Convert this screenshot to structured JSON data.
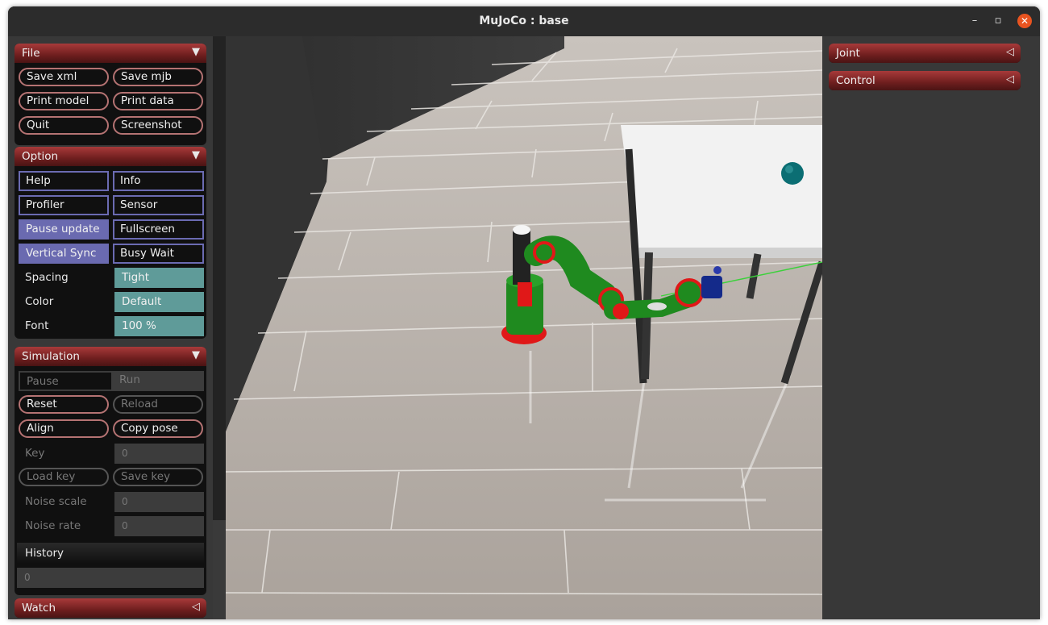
{
  "window": {
    "title": "MuJoCo : base",
    "minimize": "–",
    "maximize": "▫",
    "close": "✕"
  },
  "sections": {
    "file": {
      "title": "File",
      "arrow": "▼",
      "buttons": [
        "Save xml",
        "Save mjb",
        "Print model",
        "Print data",
        "Quit",
        "Screenshot"
      ]
    },
    "option": {
      "title": "Option",
      "arrow": "▼",
      "toggles": [
        "Help",
        "Info",
        "Profiler",
        "Sensor",
        "Pause update",
        "Fullscreen",
        "Vertical Sync",
        "Busy Wait"
      ],
      "spacing_label": "Spacing",
      "spacing_value": "Tight",
      "color_label": "Color",
      "color_value": "Default",
      "font_label": "Font",
      "font_value": "100 %"
    },
    "simulation": {
      "title": "Simulation",
      "arrow": "▼",
      "pause": "Pause",
      "run": "Run",
      "reset": "Reset",
      "reload": "Reload",
      "align": "Align",
      "copy_pose": "Copy pose",
      "key_label": "Key",
      "key_value": "0",
      "load_key": "Load key",
      "save_key": "Save key",
      "noise_scale_label": "Noise scale",
      "noise_scale_value": "0",
      "noise_rate_label": "Noise rate",
      "noise_rate_value": "0",
      "history_label": "History",
      "history_value": "0"
    },
    "watch": {
      "title": "Watch",
      "arrow": "◁"
    },
    "joint": {
      "title": "Joint",
      "arrow": "◁"
    },
    "control": {
      "title": "Control",
      "arrow": "◁"
    }
  },
  "colors": {
    "accent_red": "#a83a3a",
    "toggle_on": "#6a6ab0",
    "teal": "#5f9b99",
    "floor": "#b5ada6",
    "table": "#f2f2f2",
    "ball": "#0b6e73",
    "robot_green": "#1f8a1f",
    "robot_red": "#e01818"
  }
}
